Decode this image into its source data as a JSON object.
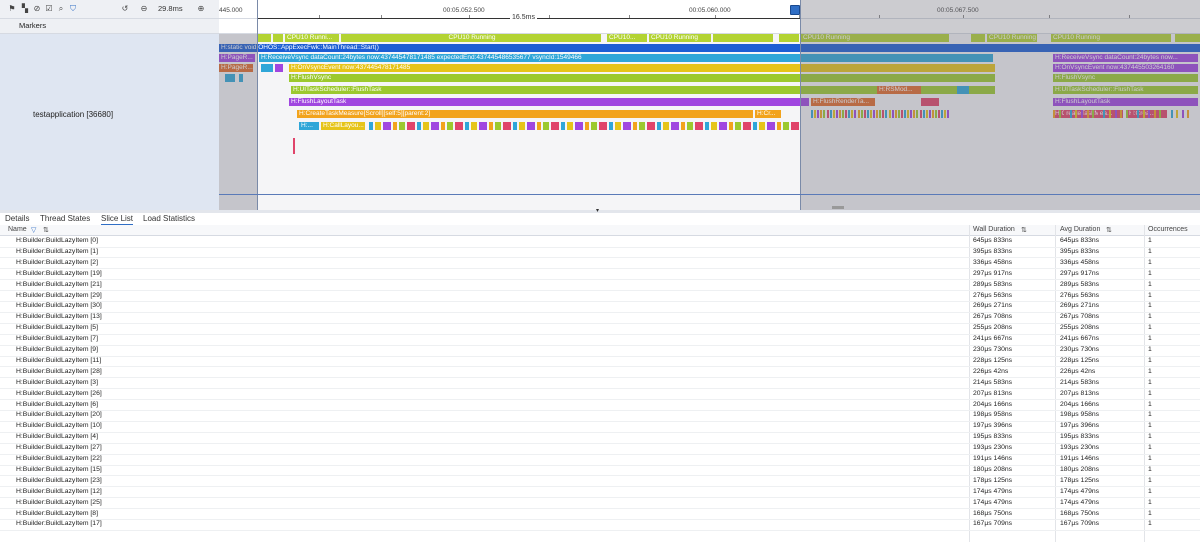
{
  "toolbar": {
    "icons": [
      "flag-icon",
      "marker-icon",
      "ban-icon",
      "checklist-icon",
      "search-icon",
      "filter-icon",
      "undo-icon",
      "zoom-out-icon",
      "zoom-in-icon"
    ],
    "zoom_level": "29.8ms"
  },
  "markers_label": "Markers",
  "process_name": "testapplication [36680]",
  "ruler": {
    "ticks": [
      "445.000",
      "00:05.052.500",
      "00:05.060.000",
      "00:05.067.500"
    ],
    "selection_span": "16.5ms"
  },
  "colors": {
    "cpu": "#b3d333",
    "blue": "#1c5ed4",
    "purple": "#a046e0",
    "orange": "#f2a31c",
    "green": "#9cc92e",
    "yellow": "#e6c419",
    "cyan": "#2fa6d8"
  },
  "track": {
    "cpu_labels": [
      "CPU10 Runni...",
      "CPU10 Running",
      "CPU10...",
      "CPU10 Running",
      "CPU10 Running",
      "CPU10 Running",
      "CPU10 Running"
    ],
    "main_thread": "H:static void OHOS::AppExecFwk::MainThread::Start()",
    "receive_vsync": "H:ReceiveVsync dataCount:24bytes now:437445478171485 expectedEnd:437445486535677 vsyncId:1549466",
    "receive_vsync_right": "H:ReceiveVsync dataCount:24bytes now...",
    "page_r": "H:PageR...",
    "on_vsync": "H:OnVsyncEvent now:437445478171485",
    "on_vsync_right": "H:OnVsyncEvent now:437445503264160",
    "flush_vsync": "H:FlushVsync",
    "flush_vsync_right": "H:FlushVsync",
    "flush_task": "H:UITaskScheduler::FlushTask",
    "flush_task_right": "H:UITaskScheduler::FlushTask",
    "rs_mod": "H:RSMod...",
    "flush_layout": "H:FlushLayoutTask",
    "flush_layout_right": "H:FlushLayoutTask",
    "flush_render": "H:FlushRenderTa...",
    "create_task": "H:CreateTaskMeasure[Scroll][self:5][parent:2]",
    "create_task_right": "H:CreateTaskMea...",
    "h_cr": "H:Cr...",
    "h_crea": "H:Crea...",
    "h_short": "H:...",
    "call_layout": "H:CallLayou..."
  },
  "tabs": [
    "Details",
    "Thread States",
    "Slice List",
    "Load Statistics"
  ],
  "active_tab": "Slice List",
  "table": {
    "headers": {
      "name": "Name",
      "wall": "Wall Duration",
      "avg": "Avg Duration",
      "occ": "Occurrences"
    },
    "rows": [
      {
        "name": "H:Builder:BuildLazyItem [0]",
        "wall": "645μs 833ns",
        "avg": "645μs 833ns",
        "occ": "1"
      },
      {
        "name": "H:Builder:BuildLazyItem [1]",
        "wall": "395μs 833ns",
        "avg": "395μs 833ns",
        "occ": "1"
      },
      {
        "name": "H:Builder:BuildLazyItem [2]",
        "wall": "336μs 458ns",
        "avg": "336μs 458ns",
        "occ": "1"
      },
      {
        "name": "H:Builder:BuildLazyItem [19]",
        "wall": "297μs 917ns",
        "avg": "297μs 917ns",
        "occ": "1"
      },
      {
        "name": "H:Builder:BuildLazyItem [21]",
        "wall": "289μs 583ns",
        "avg": "289μs 583ns",
        "occ": "1"
      },
      {
        "name": "H:Builder:BuildLazyItem [29]",
        "wall": "276μs 563ns",
        "avg": "276μs 563ns",
        "occ": "1"
      },
      {
        "name": "H:Builder:BuildLazyItem [30]",
        "wall": "269μs 271ns",
        "avg": "269μs 271ns",
        "occ": "1"
      },
      {
        "name": "H:Builder:BuildLazyItem [13]",
        "wall": "267μs 708ns",
        "avg": "267μs 708ns",
        "occ": "1"
      },
      {
        "name": "H:Builder:BuildLazyItem [5]",
        "wall": "255μs 208ns",
        "avg": "255μs 208ns",
        "occ": "1"
      },
      {
        "name": "H:Builder:BuildLazyItem [7]",
        "wall": "241μs 667ns",
        "avg": "241μs 667ns",
        "occ": "1"
      },
      {
        "name": "H:Builder:BuildLazyItem [9]",
        "wall": "230μs 730ns",
        "avg": "230μs 730ns",
        "occ": "1"
      },
      {
        "name": "H:Builder:BuildLazyItem [11]",
        "wall": "228μs 125ns",
        "avg": "228μs 125ns",
        "occ": "1"
      },
      {
        "name": "H:Builder:BuildLazyItem [28]",
        "wall": "226μs 42ns",
        "avg": "226μs 42ns",
        "occ": "1"
      },
      {
        "name": "H:Builder:BuildLazyItem [3]",
        "wall": "214μs 583ns",
        "avg": "214μs 583ns",
        "occ": "1"
      },
      {
        "name": "H:Builder:BuildLazyItem [26]",
        "wall": "207μs 813ns",
        "avg": "207μs 813ns",
        "occ": "1"
      },
      {
        "name": "H:Builder:BuildLazyItem [6]",
        "wall": "204μs 166ns",
        "avg": "204μs 166ns",
        "occ": "1"
      },
      {
        "name": "H:Builder:BuildLazyItem [20]",
        "wall": "198μs 958ns",
        "avg": "198μs 958ns",
        "occ": "1"
      },
      {
        "name": "H:Builder:BuildLazyItem [10]",
        "wall": "197μs 396ns",
        "avg": "197μs 396ns",
        "occ": "1"
      },
      {
        "name": "H:Builder:BuildLazyItem [4]",
        "wall": "195μs 833ns",
        "avg": "195μs 833ns",
        "occ": "1"
      },
      {
        "name": "H:Builder:BuildLazyItem [27]",
        "wall": "193μs 230ns",
        "avg": "193μs 230ns",
        "occ": "1"
      },
      {
        "name": "H:Builder:BuildLazyItem [22]",
        "wall": "191μs 146ns",
        "avg": "191μs 146ns",
        "occ": "1"
      },
      {
        "name": "H:Builder:BuildLazyItem [15]",
        "wall": "180μs 208ns",
        "avg": "180μs 208ns",
        "occ": "1"
      },
      {
        "name": "H:Builder:BuildLazyItem [23]",
        "wall": "178μs 125ns",
        "avg": "178μs 125ns",
        "occ": "1"
      },
      {
        "name": "H:Builder:BuildLazyItem [12]",
        "wall": "174μs 479ns",
        "avg": "174μs 479ns",
        "occ": "1"
      },
      {
        "name": "H:Builder:BuildLazyItem [25]",
        "wall": "174μs 479ns",
        "avg": "174μs 479ns",
        "occ": "1"
      },
      {
        "name": "H:Builder:BuildLazyItem [8]",
        "wall": "168μs 750ns",
        "avg": "168μs 750ns",
        "occ": "1"
      },
      {
        "name": "H:Builder:BuildLazyItem [17]",
        "wall": "167μs 709ns",
        "avg": "167μs 709ns",
        "occ": "1"
      }
    ]
  }
}
